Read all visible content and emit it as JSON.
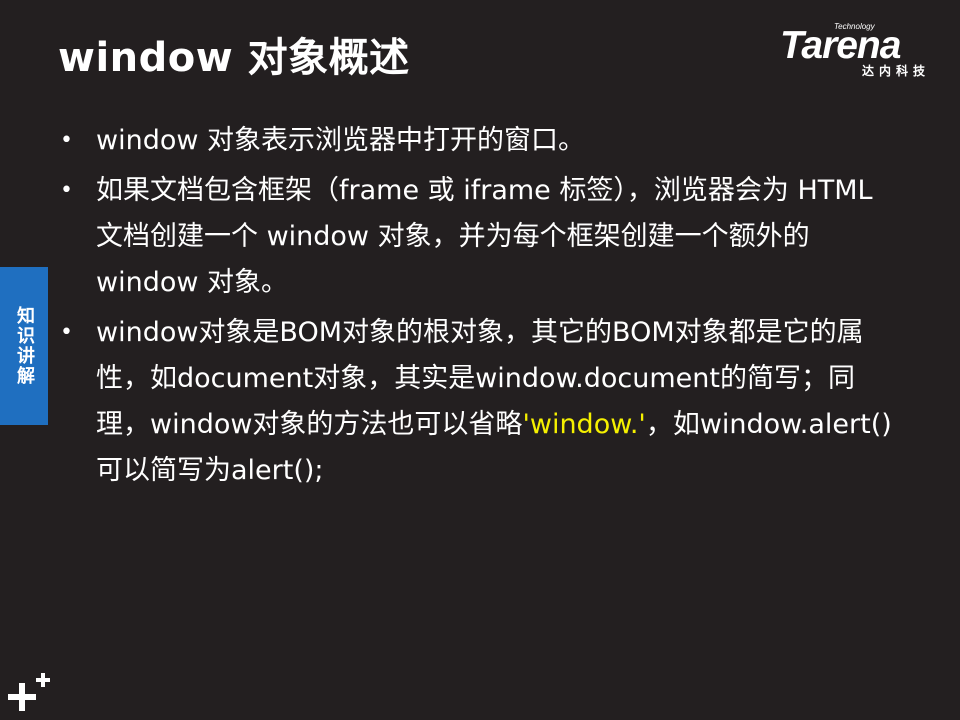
{
  "title": "window 对象概述",
  "logo": {
    "tagline": "Technology",
    "brand": "Tarena",
    "chinese": "达内科技"
  },
  "side_tab": {
    "label": "知识讲解"
  },
  "bullets": [
    {
      "text": "window 对象表示浏览器中打开的窗口。"
    },
    {
      "text": "如果文档包含框架（frame 或 iframe 标签），浏览器会为 HTML 文档创建一个 window 对象，并为每个框架创建一个额外的 window 对象。"
    },
    {
      "text_before": "window对象是BOM对象的根对象，其它的BOM对象都是它的属性，如document对象，其实是window.document的简写；同理，window对象的方法也可以省略",
      "highlight": "'window.'",
      "text_after": "，如window.alert()可以简写为alert();"
    }
  ],
  "colors": {
    "background": "#231f20",
    "text": "#ffffff",
    "highlight": "#f5f000",
    "side_tab": "#1f6fc0"
  },
  "icons": {
    "bottom_left": "plus-plus-icon",
    "bullet": "bullet-dot-icon"
  }
}
